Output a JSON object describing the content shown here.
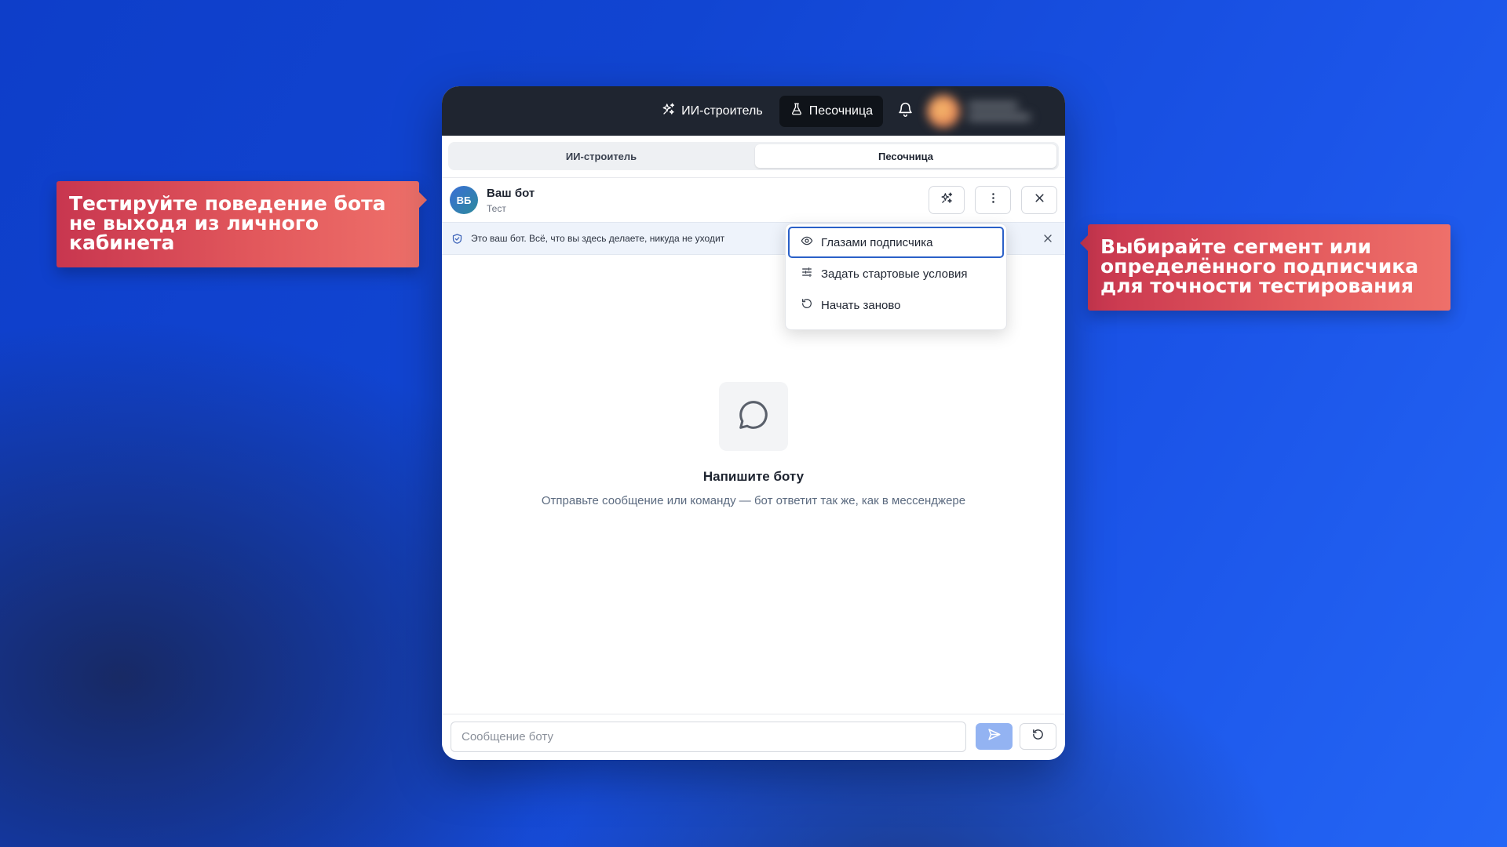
{
  "callouts": {
    "left": [
      "Тестируйте поведение бота",
      "не выходя из личного",
      "кабинета"
    ],
    "right": [
      "Выбирайте сегмент или",
      "определённого подписчика",
      "для точности тестирования"
    ]
  },
  "topbar": {
    "ai_builder_label": "ИИ-строитель",
    "sandbox_label": "Песочница"
  },
  "tabs": [
    {
      "label": "ИИ-строитель"
    },
    {
      "label": "Песочница"
    }
  ],
  "bot": {
    "avatar_initials": "ВБ",
    "name": "Ваш бот",
    "subtitle": "Тест"
  },
  "notice": {
    "text": "Это ваш бот. Всё, что вы здесь делаете, никуда не уходит"
  },
  "menu": {
    "items": [
      {
        "label": "Глазами подписчика",
        "icon": "eye-icon"
      },
      {
        "label": "Задать стартовые условия",
        "icon": "sliders-icon"
      },
      {
        "label": "Начать заново",
        "icon": "restart-icon"
      }
    ]
  },
  "empty_state": {
    "title": "Напишите боту",
    "description": "Отправьте сообщение или команду — бот ответит так же, как в мессенджере"
  },
  "composer": {
    "placeholder": "Сообщение боту"
  },
  "colors": {
    "accent": "#2a60c8",
    "topbar": "#1f2530",
    "send_button": "#93b3f2",
    "callout": "#e2585c"
  }
}
